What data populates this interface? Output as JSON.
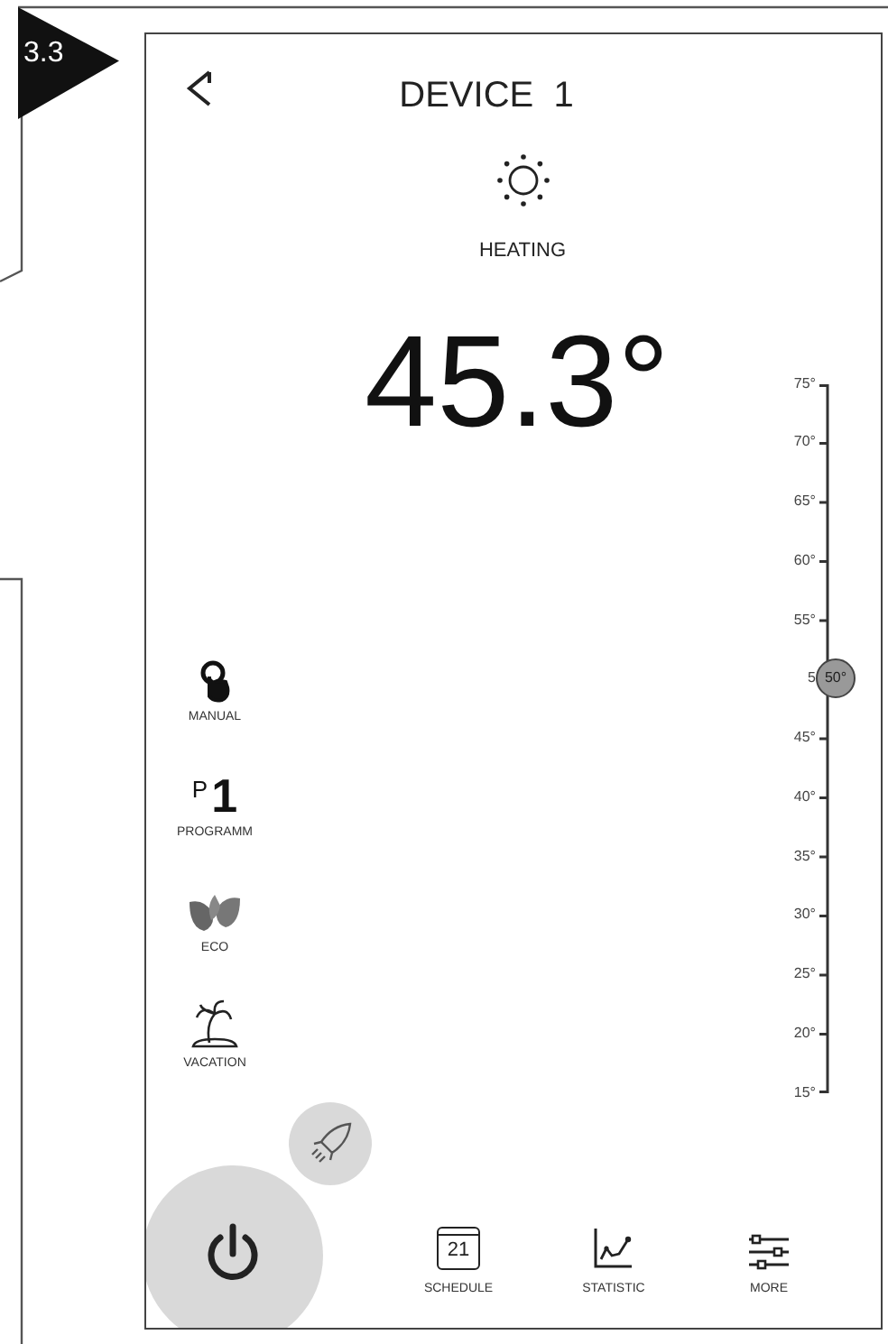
{
  "badge": "3.3",
  "header": {
    "title": "DEVICE  1"
  },
  "status": {
    "mode_label": "HEATING",
    "temperature": "45.3°"
  },
  "modes": [
    {
      "kind": "manual",
      "label": "MANUAL"
    },
    {
      "kind": "program",
      "label": "PROGRAMM",
      "icon_prefix": "P",
      "icon_number": "1"
    },
    {
      "kind": "eco",
      "label": "ECO"
    },
    {
      "kind": "vacation",
      "label": "VACATION"
    }
  ],
  "scale": {
    "ticks": [
      "75°",
      "70°",
      "65°",
      "60°",
      "55°",
      "5",
      "45°",
      "40°",
      "35°",
      "30°",
      "25°",
      "20°",
      "15°"
    ],
    "level": 0.583,
    "thumb_label": "50°"
  },
  "nav": [
    {
      "kind": "schedule",
      "label": "SCHEDULE",
      "icon_text": "21"
    },
    {
      "kind": "statistic",
      "label": "STATISTIC"
    },
    {
      "kind": "more",
      "label": "MORE"
    }
  ]
}
